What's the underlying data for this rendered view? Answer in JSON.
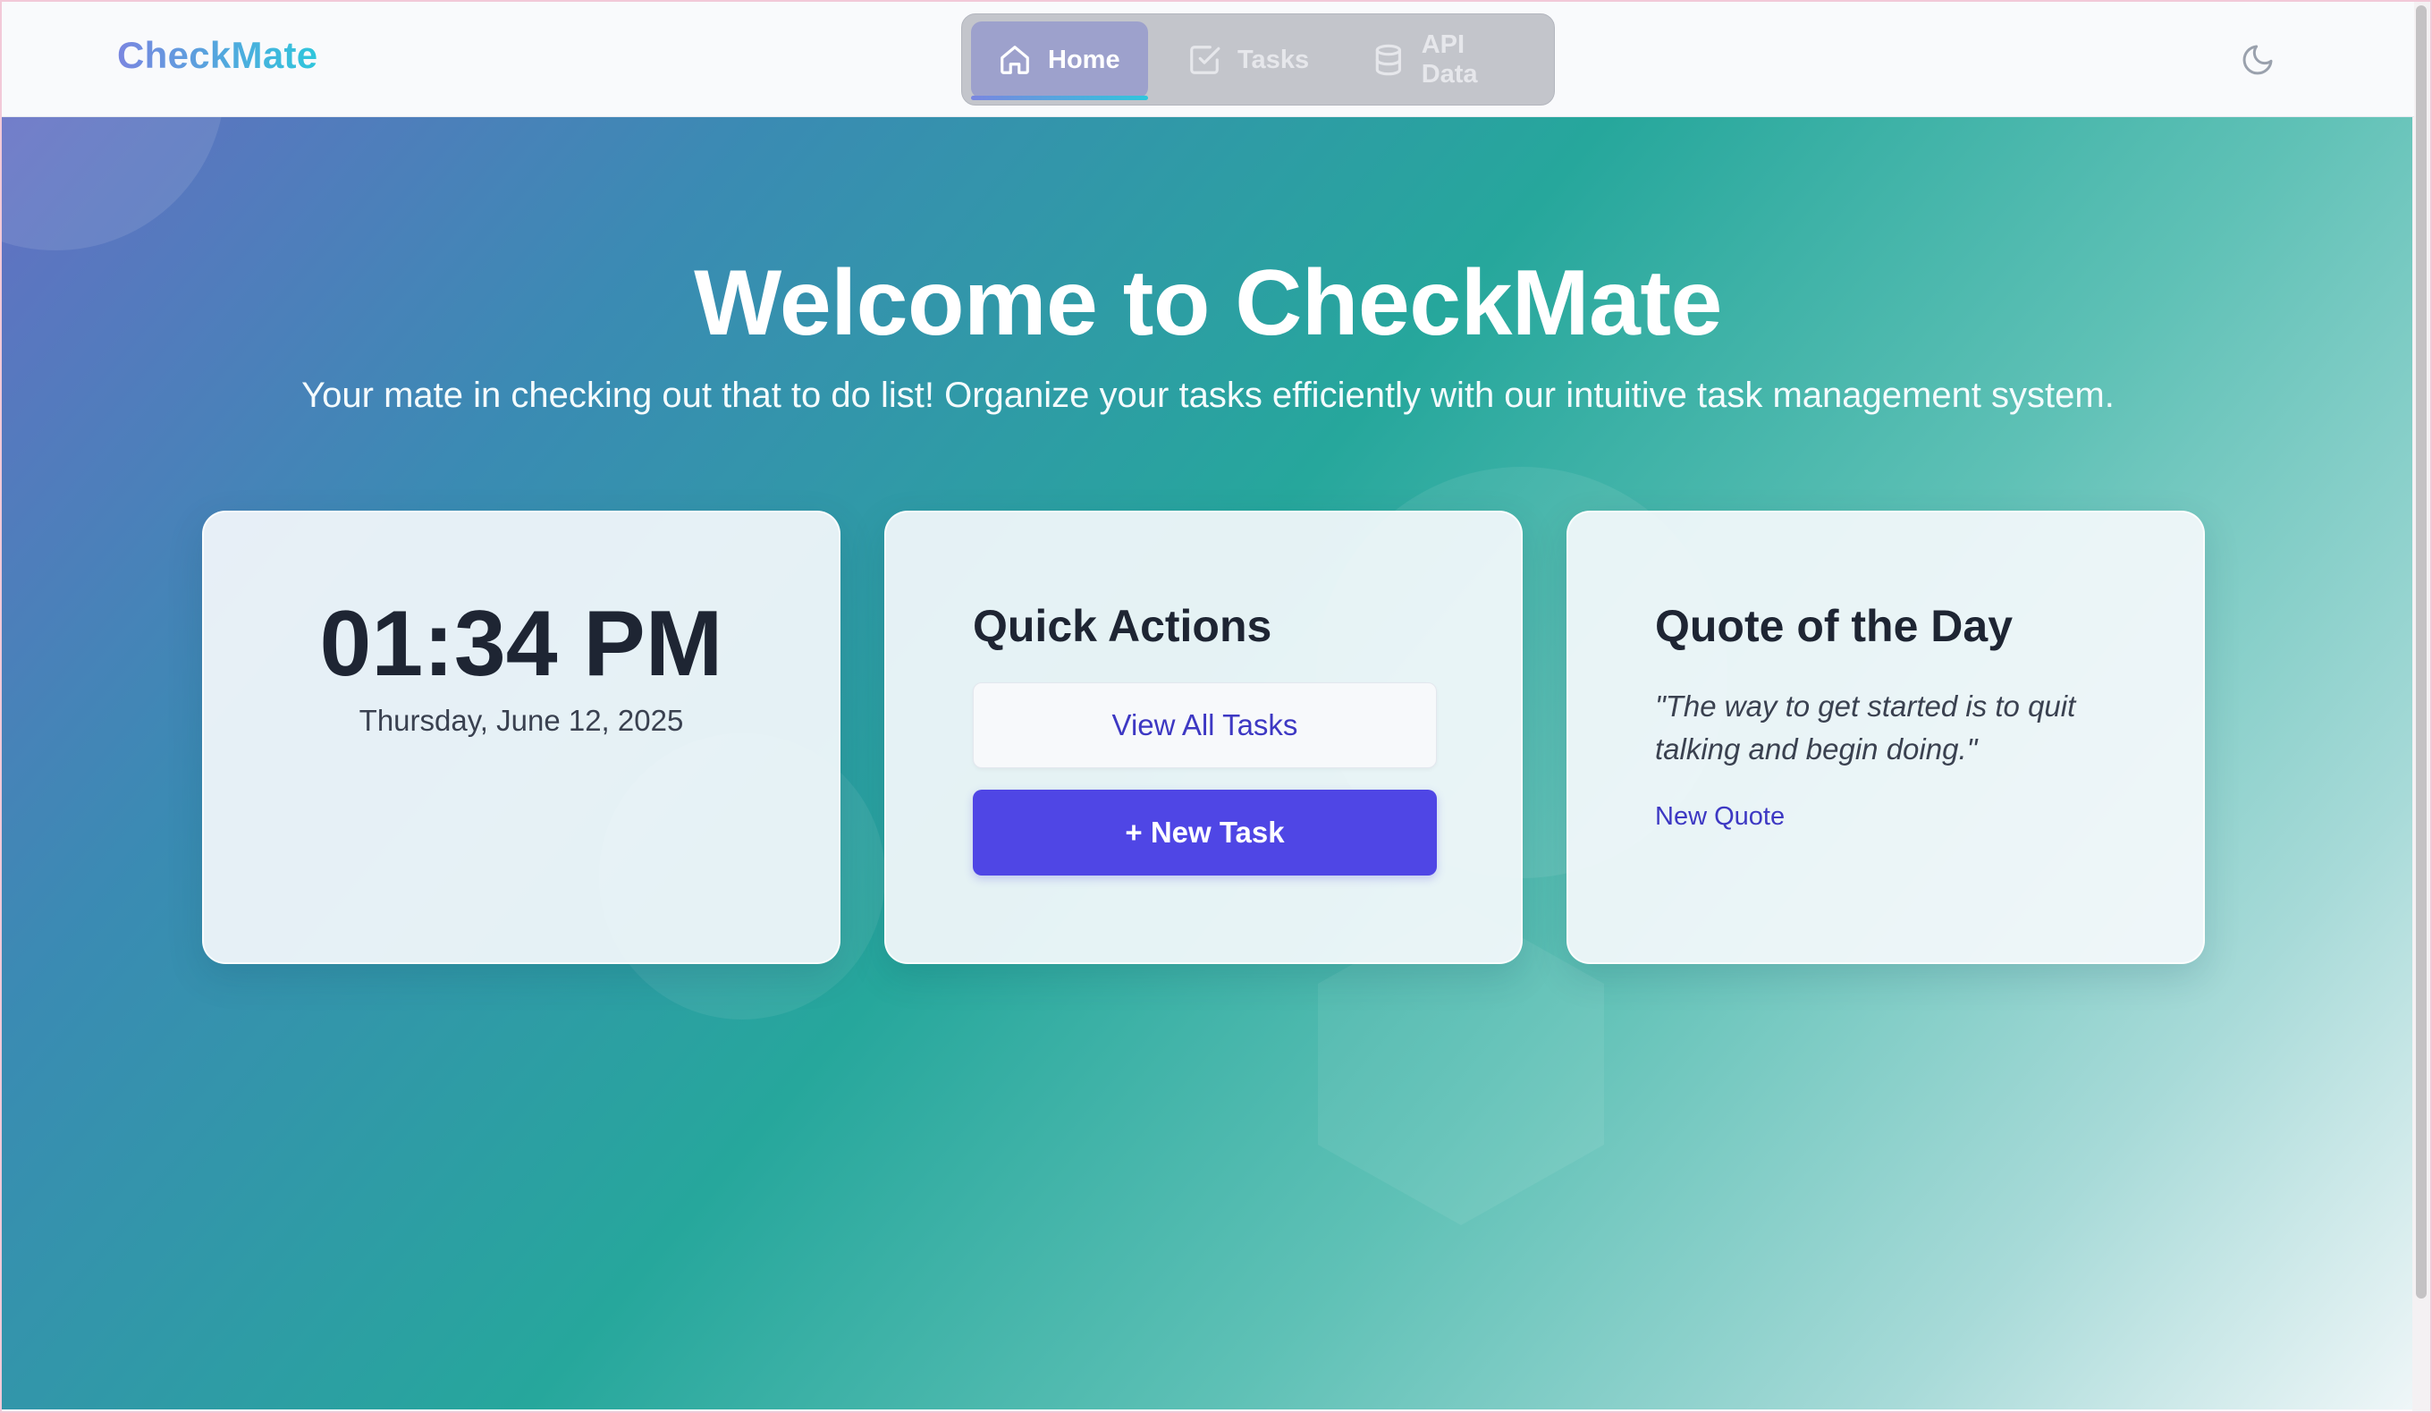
{
  "app": {
    "brand": "CheckMate"
  },
  "nav": {
    "items": [
      {
        "label": "Home",
        "icon": "home-icon",
        "active": true
      },
      {
        "label": "Tasks",
        "icon": "checkbox-icon",
        "active": false
      },
      {
        "label": "API Data",
        "icon": "database-icon",
        "active": false
      }
    ]
  },
  "theme_toggle": {
    "icon": "moon-icon"
  },
  "hero": {
    "title": "Welcome to CheckMate",
    "subtitle": "Your mate in checking out that to do list! Organize your tasks efficiently with our intuitive task management system."
  },
  "clock": {
    "time": "01:34 PM",
    "date": "Thursday, June 12, 2025"
  },
  "quick_actions": {
    "title": "Quick Actions",
    "view_all_label": "View All Tasks",
    "new_task_label": "+ New Task"
  },
  "quote": {
    "title": "Quote of the Day",
    "text": "\"The way to get started is to quit talking and begin doing.\"",
    "new_quote_label": "New Quote"
  },
  "colors": {
    "accent": "#4f46e5",
    "accent_text": "#3d38c3",
    "brand_gradient_start": "#7a86e0",
    "brand_gradient_end": "#2fc6dc",
    "heading_text": "#1e2533"
  }
}
